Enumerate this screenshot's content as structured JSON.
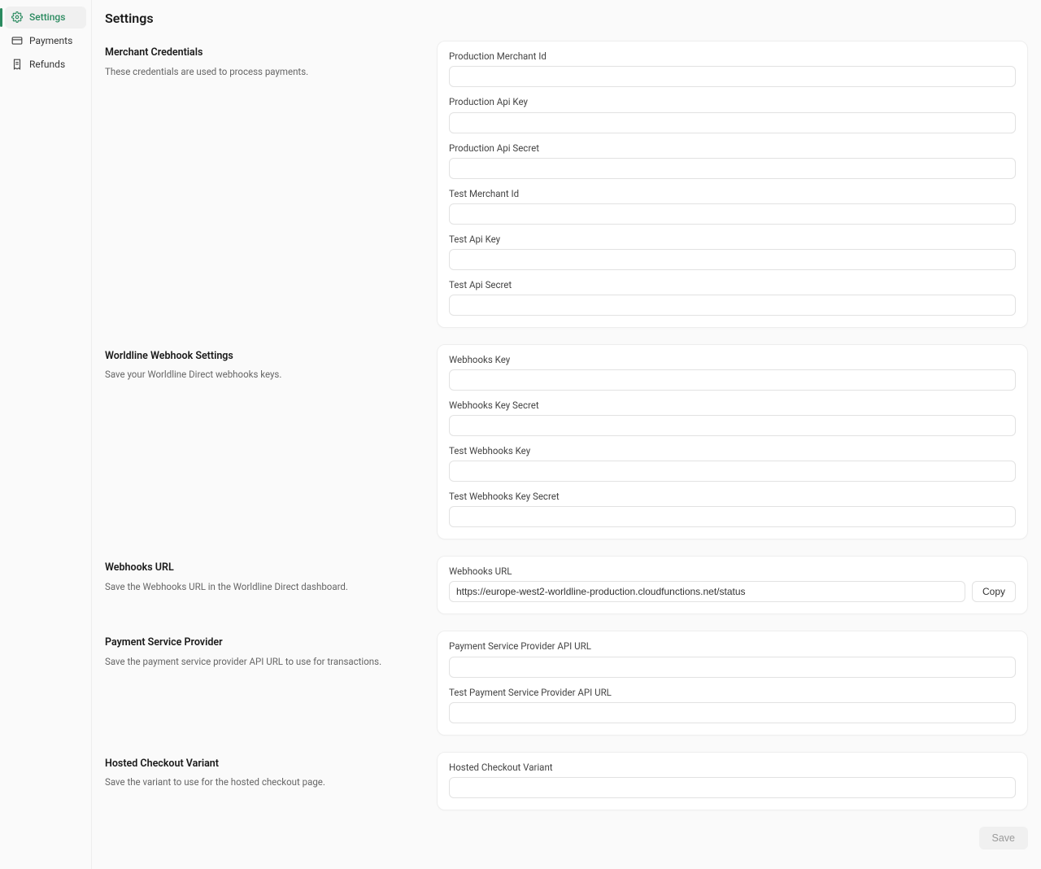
{
  "sidebar": {
    "items": [
      {
        "label": "Settings",
        "icon": "gear-icon",
        "active": true
      },
      {
        "label": "Payments",
        "icon": "card-icon",
        "active": false
      },
      {
        "label": "Refunds",
        "icon": "receipt-icon",
        "active": false
      }
    ]
  },
  "page_title": "Settings",
  "sections": {
    "merchant_credentials": {
      "title": "Merchant Credentials",
      "desc": "These credentials are used to process payments.",
      "fields": [
        {
          "label": "Production Merchant Id",
          "value": ""
        },
        {
          "label": "Production Api Key",
          "value": ""
        },
        {
          "label": "Production Api Secret",
          "value": ""
        },
        {
          "label": "Test Merchant Id",
          "value": ""
        },
        {
          "label": "Test Api Key",
          "value": ""
        },
        {
          "label": "Test Api Secret",
          "value": ""
        }
      ]
    },
    "webhook_settings": {
      "title": "Worldline Webhook Settings",
      "desc": "Save your Worldline Direct webhooks keys.",
      "fields": [
        {
          "label": "Webhooks Key",
          "value": ""
        },
        {
          "label": "Webhooks Key Secret",
          "value": ""
        },
        {
          "label": "Test Webhooks Key",
          "value": ""
        },
        {
          "label": "Test Webhooks Key Secret",
          "value": ""
        }
      ]
    },
    "webhooks_url": {
      "title": "Webhooks URL",
      "desc": "Save the Webhooks URL in the Worldline Direct dashboard.",
      "field_label": "Webhooks URL",
      "value": "https://europe-west2-worldline-production.cloudfunctions.net/status",
      "copy_label": "Copy"
    },
    "psp": {
      "title": "Payment Service Provider",
      "desc": "Save the payment service provider API URL to use for transactions.",
      "fields": [
        {
          "label": "Payment Service Provider API URL",
          "value": ""
        },
        {
          "label": "Test Payment Service Provider API URL",
          "value": ""
        }
      ]
    },
    "hosted_checkout": {
      "title": "Hosted Checkout Variant",
      "desc": "Save the variant to use for the hosted checkout page.",
      "field_label": "Hosted Checkout Variant",
      "value": ""
    }
  },
  "save_label": "Save"
}
